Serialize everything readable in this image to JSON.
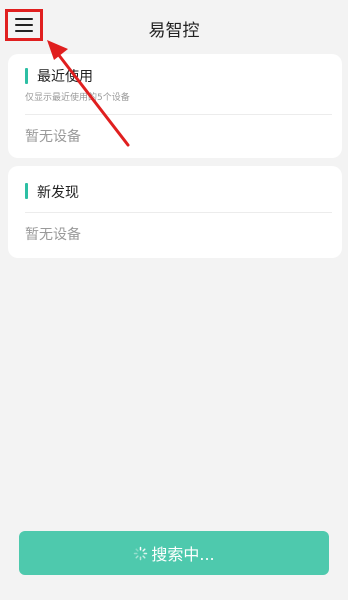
{
  "header": {
    "title": "易智控",
    "menu_icon": "hamburger-menu-icon"
  },
  "recent": {
    "title": "最近使用",
    "subtitle": "仅显示最近使用的5个设备",
    "empty_text": "暂无设备"
  },
  "discover": {
    "title": "新发现",
    "empty_text": "暂无设备"
  },
  "search_button": {
    "label": "搜索中...",
    "icon": "loading-spinner-icon"
  },
  "colors": {
    "accent": "#2dbfa4",
    "button": "#4ec9ad",
    "annotation": "#e01f1f",
    "background": "#f3f3f3"
  }
}
